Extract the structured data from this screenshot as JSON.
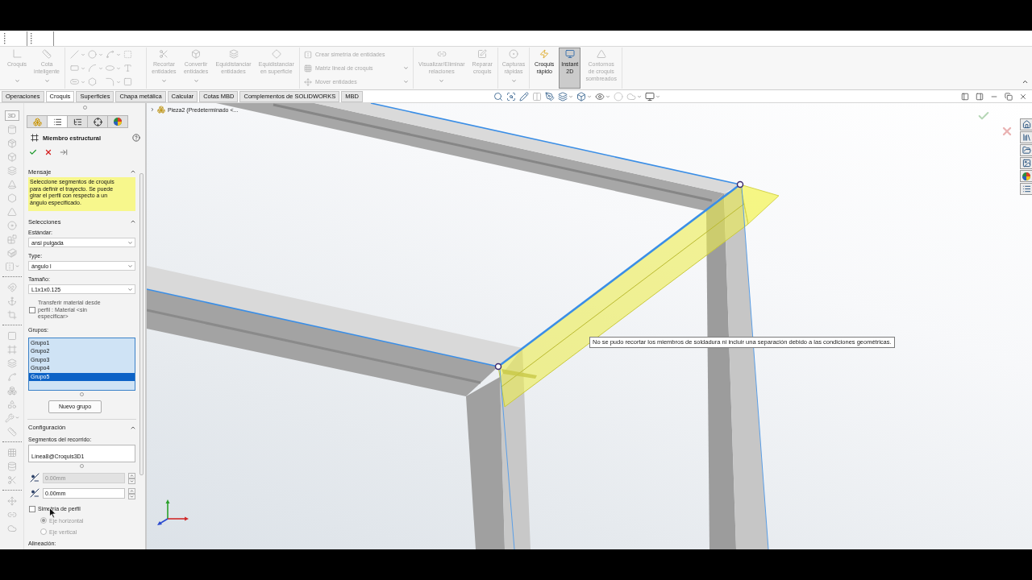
{
  "ribbon": {
    "sketch_buttons": [
      {
        "label": "Croquis",
        "disabled": true,
        "menu": true
      },
      {
        "label": "Cota\ninteligente",
        "disabled": true,
        "menu": true
      }
    ],
    "entity_buttons": [
      {
        "label": "Recortar\nentidades",
        "disabled": true,
        "menu": true
      },
      {
        "label": "Convertir\nentidades",
        "disabled": true,
        "menu": true
      },
      {
        "label": "Equidistanciar\nentidades",
        "disabled": true,
        "menu": false
      },
      {
        "label": "Equidistanciar\nen superficie",
        "disabled": true,
        "menu": false
      }
    ],
    "entity_commands": [
      {
        "label": "Crear simetría de entidades",
        "disabled": true,
        "menu": false
      },
      {
        "label": "Matriz lineal de croquis",
        "disabled": true,
        "menu": true
      },
      {
        "label": "Mover entidades",
        "disabled": true,
        "menu": true
      }
    ],
    "relation_buttons": [
      {
        "label": "Visualizar/Eliminar\nrelaciones",
        "disabled": true,
        "menu": true
      },
      {
        "label": "Reparar\ncroquis",
        "disabled": true,
        "menu": false
      }
    ],
    "capture_buttons": [
      {
        "label": "Capturas\nrápidas",
        "disabled": true,
        "menu": true
      }
    ],
    "mode_buttons": [
      {
        "label": "Croquis\nrápido",
        "disabled": false,
        "selected": false
      },
      {
        "label": "Instant\n2D",
        "disabled": false,
        "selected": true
      },
      {
        "label": "Contornos\nde croquis\nsombreados",
        "disabled": true,
        "selected": false
      }
    ]
  },
  "tabs": [
    {
      "label": "Operaciones",
      "selected": false
    },
    {
      "label": "Croquis",
      "selected": true
    },
    {
      "label": "Superficies",
      "selected": false
    },
    {
      "label": "Chapa metálica",
      "selected": false
    },
    {
      "label": "Calcular",
      "selected": false
    },
    {
      "label": "Cotas MBD",
      "selected": false
    },
    {
      "label": "Complementos de SOLIDWORKS",
      "selected": false
    },
    {
      "label": "MBD",
      "selected": false
    }
  ],
  "left_toolbar": {
    "badge": "3D"
  },
  "property_manager": {
    "tabs": [
      {
        "selected": false
      },
      {
        "selected": true
      },
      {
        "selected": false
      },
      {
        "selected": false
      },
      {
        "selected": false
      }
    ],
    "title": "Miembro estructural",
    "message": {
      "title": "Mensaje",
      "expanded": true,
      "text": "Seleccione segmentos de croquis para definir el trayecto. Se puede girar el perfil con respecto a un ángulo especificado."
    },
    "selections": {
      "title": "Selecciones",
      "expanded": true,
      "fields": [
        {
          "label": "Estándar:",
          "value": "ansi pulgada"
        },
        {
          "label": "Type:",
          "value": "ángulo l"
        },
        {
          "label": "Tamaño:",
          "value": "L1x1x0.125"
        }
      ],
      "transfer_material": {
        "label": "Transferir material desde perfil : Material <sin especificar>",
        "checked": false
      },
      "groups_label": "Grupos:",
      "groups": [
        {
          "name": "Grupo1",
          "selected": false
        },
        {
          "name": "Grupo2",
          "selected": false
        },
        {
          "name": "Grupo3",
          "selected": false
        },
        {
          "name": "Grupo4",
          "selected": false
        },
        {
          "name": "Grupo5",
          "selected": true
        }
      ],
      "new_group_button": "Nuevo grupo"
    },
    "configuration": {
      "title": "Configuración",
      "expanded": true,
      "segments_label": "Segmentos del recorrido:",
      "segments": [
        "Línea8@Croquis3D1"
      ],
      "offsets": [
        {
          "value": "0.00mm",
          "disabled": true
        },
        {
          "value": "0.00mm",
          "disabled": false
        }
      ],
      "mirror_profile": {
        "label": "Simetría de perfil",
        "checked": false
      },
      "axes": [
        {
          "label": "Eje horizontal",
          "selected": true,
          "disabled": true
        },
        {
          "label": "Eje vertical",
          "selected": false,
          "disabled": true
        }
      ],
      "alignment_label": "Alineación:"
    }
  },
  "feature_tree": {
    "expanded": false,
    "label": "Pieza2 (Predeterminado <..."
  },
  "tooltip": "No se pudo recortar los miembros de soldadura ni incluir una separación debido a las condiciones geométricas."
}
